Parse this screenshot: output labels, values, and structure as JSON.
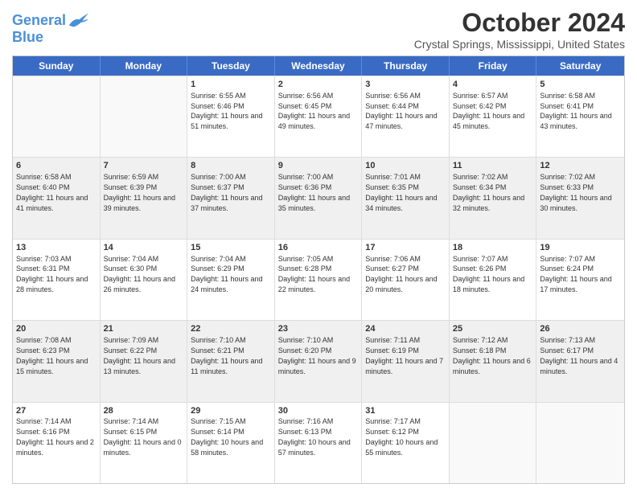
{
  "logo": {
    "line1": "General",
    "line2": "Blue"
  },
  "title": "October 2024",
  "subtitle": "Crystal Springs, Mississippi, United States",
  "days": [
    "Sunday",
    "Monday",
    "Tuesday",
    "Wednesday",
    "Thursday",
    "Friday",
    "Saturday"
  ],
  "weeks": [
    [
      {
        "day": "",
        "sunrise": "",
        "sunset": "",
        "daylight": "",
        "empty": true
      },
      {
        "day": "",
        "sunrise": "",
        "sunset": "",
        "daylight": "",
        "empty": true
      },
      {
        "day": "1",
        "sunrise": "Sunrise: 6:55 AM",
        "sunset": "Sunset: 6:46 PM",
        "daylight": "Daylight: 11 hours and 51 minutes."
      },
      {
        "day": "2",
        "sunrise": "Sunrise: 6:56 AM",
        "sunset": "Sunset: 6:45 PM",
        "daylight": "Daylight: 11 hours and 49 minutes."
      },
      {
        "day": "3",
        "sunrise": "Sunrise: 6:56 AM",
        "sunset": "Sunset: 6:44 PM",
        "daylight": "Daylight: 11 hours and 47 minutes."
      },
      {
        "day": "4",
        "sunrise": "Sunrise: 6:57 AM",
        "sunset": "Sunset: 6:42 PM",
        "daylight": "Daylight: 11 hours and 45 minutes."
      },
      {
        "day": "5",
        "sunrise": "Sunrise: 6:58 AM",
        "sunset": "Sunset: 6:41 PM",
        "daylight": "Daylight: 11 hours and 43 minutes."
      }
    ],
    [
      {
        "day": "6",
        "sunrise": "Sunrise: 6:58 AM",
        "sunset": "Sunset: 6:40 PM",
        "daylight": "Daylight: 11 hours and 41 minutes."
      },
      {
        "day": "7",
        "sunrise": "Sunrise: 6:59 AM",
        "sunset": "Sunset: 6:39 PM",
        "daylight": "Daylight: 11 hours and 39 minutes."
      },
      {
        "day": "8",
        "sunrise": "Sunrise: 7:00 AM",
        "sunset": "Sunset: 6:37 PM",
        "daylight": "Daylight: 11 hours and 37 minutes."
      },
      {
        "day": "9",
        "sunrise": "Sunrise: 7:00 AM",
        "sunset": "Sunset: 6:36 PM",
        "daylight": "Daylight: 11 hours and 35 minutes."
      },
      {
        "day": "10",
        "sunrise": "Sunrise: 7:01 AM",
        "sunset": "Sunset: 6:35 PM",
        "daylight": "Daylight: 11 hours and 34 minutes."
      },
      {
        "day": "11",
        "sunrise": "Sunrise: 7:02 AM",
        "sunset": "Sunset: 6:34 PM",
        "daylight": "Daylight: 11 hours and 32 minutes."
      },
      {
        "day": "12",
        "sunrise": "Sunrise: 7:02 AM",
        "sunset": "Sunset: 6:33 PM",
        "daylight": "Daylight: 11 hours and 30 minutes."
      }
    ],
    [
      {
        "day": "13",
        "sunrise": "Sunrise: 7:03 AM",
        "sunset": "Sunset: 6:31 PM",
        "daylight": "Daylight: 11 hours and 28 minutes."
      },
      {
        "day": "14",
        "sunrise": "Sunrise: 7:04 AM",
        "sunset": "Sunset: 6:30 PM",
        "daylight": "Daylight: 11 hours and 26 minutes."
      },
      {
        "day": "15",
        "sunrise": "Sunrise: 7:04 AM",
        "sunset": "Sunset: 6:29 PM",
        "daylight": "Daylight: 11 hours and 24 minutes."
      },
      {
        "day": "16",
        "sunrise": "Sunrise: 7:05 AM",
        "sunset": "Sunset: 6:28 PM",
        "daylight": "Daylight: 11 hours and 22 minutes."
      },
      {
        "day": "17",
        "sunrise": "Sunrise: 7:06 AM",
        "sunset": "Sunset: 6:27 PM",
        "daylight": "Daylight: 11 hours and 20 minutes."
      },
      {
        "day": "18",
        "sunrise": "Sunrise: 7:07 AM",
        "sunset": "Sunset: 6:26 PM",
        "daylight": "Daylight: 11 hours and 18 minutes."
      },
      {
        "day": "19",
        "sunrise": "Sunrise: 7:07 AM",
        "sunset": "Sunset: 6:24 PM",
        "daylight": "Daylight: 11 hours and 17 minutes."
      }
    ],
    [
      {
        "day": "20",
        "sunrise": "Sunrise: 7:08 AM",
        "sunset": "Sunset: 6:23 PM",
        "daylight": "Daylight: 11 hours and 15 minutes."
      },
      {
        "day": "21",
        "sunrise": "Sunrise: 7:09 AM",
        "sunset": "Sunset: 6:22 PM",
        "daylight": "Daylight: 11 hours and 13 minutes."
      },
      {
        "day": "22",
        "sunrise": "Sunrise: 7:10 AM",
        "sunset": "Sunset: 6:21 PM",
        "daylight": "Daylight: 11 hours and 11 minutes."
      },
      {
        "day": "23",
        "sunrise": "Sunrise: 7:10 AM",
        "sunset": "Sunset: 6:20 PM",
        "daylight": "Daylight: 11 hours and 9 minutes."
      },
      {
        "day": "24",
        "sunrise": "Sunrise: 7:11 AM",
        "sunset": "Sunset: 6:19 PM",
        "daylight": "Daylight: 11 hours and 7 minutes."
      },
      {
        "day": "25",
        "sunrise": "Sunrise: 7:12 AM",
        "sunset": "Sunset: 6:18 PM",
        "daylight": "Daylight: 11 hours and 6 minutes."
      },
      {
        "day": "26",
        "sunrise": "Sunrise: 7:13 AM",
        "sunset": "Sunset: 6:17 PM",
        "daylight": "Daylight: 11 hours and 4 minutes."
      }
    ],
    [
      {
        "day": "27",
        "sunrise": "Sunrise: 7:14 AM",
        "sunset": "Sunset: 6:16 PM",
        "daylight": "Daylight: 11 hours and 2 minutes."
      },
      {
        "day": "28",
        "sunrise": "Sunrise: 7:14 AM",
        "sunset": "Sunset: 6:15 PM",
        "daylight": "Daylight: 11 hours and 0 minutes."
      },
      {
        "day": "29",
        "sunrise": "Sunrise: 7:15 AM",
        "sunset": "Sunset: 6:14 PM",
        "daylight": "Daylight: 10 hours and 58 minutes."
      },
      {
        "day": "30",
        "sunrise": "Sunrise: 7:16 AM",
        "sunset": "Sunset: 6:13 PM",
        "daylight": "Daylight: 10 hours and 57 minutes."
      },
      {
        "day": "31",
        "sunrise": "Sunrise: 7:17 AM",
        "sunset": "Sunset: 6:12 PM",
        "daylight": "Daylight: 10 hours and 55 minutes."
      },
      {
        "day": "",
        "sunrise": "",
        "sunset": "",
        "daylight": "",
        "empty": true
      },
      {
        "day": "",
        "sunrise": "",
        "sunset": "",
        "daylight": "",
        "empty": true
      }
    ]
  ]
}
